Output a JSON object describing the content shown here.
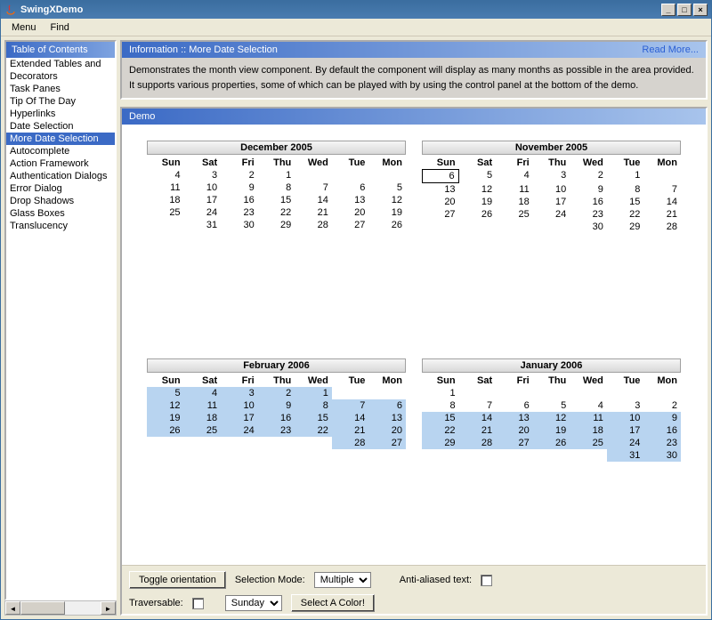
{
  "window": {
    "title": "SwingXDemo"
  },
  "menubar": {
    "items": [
      "Menu",
      "Find"
    ]
  },
  "sidebar": {
    "header": "Table of Contents",
    "items": [
      "Extended Tables and",
      "Decorators",
      "Task Panes",
      "Tip Of The Day",
      "Hyperlinks",
      "Date Selection",
      "More Date Selection",
      "Autocomplete",
      "Action Framework",
      "Authentication Dialogs",
      "Error Dialog",
      "Drop Shadows",
      "Glass Boxes",
      "Translucency"
    ],
    "selected_index": 6
  },
  "info": {
    "header": "Information :: More Date Selection",
    "read_more": "Read More...",
    "body": "Demonstrates the month view component. By default the component will display as many months as possible in the area provided. It supports various properties, some of which can be played with by using the control panel at the bottom of the demo."
  },
  "demo": {
    "header": "Demo"
  },
  "months": {
    "top_left": {
      "label": "December 2005",
      "days": [
        "Sun",
        "Sat",
        "Fri",
        "Thu",
        "Wed",
        "Tue",
        "Mon"
      ],
      "weeks": [
        [
          "4",
          "3",
          "2",
          "1",
          "",
          "",
          ""
        ],
        [
          "11",
          "10",
          "9",
          "8",
          "7",
          "6",
          "5"
        ],
        [
          "18",
          "17",
          "16",
          "15",
          "14",
          "13",
          "12"
        ],
        [
          "25",
          "24",
          "23",
          "22",
          "21",
          "20",
          "19"
        ],
        [
          "",
          "31",
          "30",
          "29",
          "28",
          "27",
          "26"
        ]
      ]
    },
    "top_right": {
      "label": "November 2005",
      "days": [
        "Sun",
        "Sat",
        "Fri",
        "Thu",
        "Wed",
        "Tue",
        "Mon"
      ],
      "today": "6",
      "weeks": [
        [
          "6",
          "5",
          "4",
          "3",
          "2",
          "1",
          ""
        ],
        [
          "13",
          "12",
          "11",
          "10",
          "9",
          "8",
          "7"
        ],
        [
          "20",
          "19",
          "18",
          "17",
          "16",
          "15",
          "14"
        ],
        [
          "27",
          "26",
          "25",
          "24",
          "23",
          "22",
          "21"
        ],
        [
          "",
          "",
          "",
          "",
          "30",
          "29",
          "28"
        ]
      ]
    },
    "bottom_left": {
      "label": "February 2006",
      "days": [
        "Sun",
        "Sat",
        "Fri",
        "Thu",
        "Wed",
        "Tue",
        "Mon"
      ],
      "weeks": [
        [
          "5",
          "4",
          "3",
          "2",
          "1",
          "",
          ""
        ],
        [
          "12",
          "11",
          "10",
          "9",
          "8",
          "7",
          "6"
        ],
        [
          "19",
          "18",
          "17",
          "16",
          "15",
          "14",
          "13"
        ],
        [
          "26",
          "25",
          "24",
          "23",
          "22",
          "21",
          "20"
        ],
        [
          "",
          "",
          "",
          "",
          "",
          "28",
          "27"
        ]
      ],
      "highlight_all": true
    },
    "bottom_right": {
      "label": "January 2006",
      "days": [
        "Sun",
        "Sat",
        "Fri",
        "Thu",
        "Wed",
        "Tue",
        "Mon"
      ],
      "weeks": [
        [
          "1",
          "",
          "",
          "",
          "",
          "",
          ""
        ],
        [
          "8",
          "7",
          "6",
          "5",
          "4",
          "3",
          "2"
        ],
        [
          "15",
          "14",
          "13",
          "12",
          "11",
          "10",
          "9"
        ],
        [
          "22",
          "21",
          "20",
          "19",
          "18",
          "17",
          "16"
        ],
        [
          "29",
          "28",
          "27",
          "26",
          "25",
          "24",
          "23"
        ],
        [
          "",
          "",
          "",
          "",
          "",
          "31",
          "30"
        ]
      ],
      "highlight_from": {
        "row": 2,
        "col": 0
      }
    }
  },
  "controls": {
    "toggle_orientation": "Toggle orientation",
    "selection_mode_label": "Selection Mode:",
    "selection_mode_value": "Multiple",
    "anti_aliased_label": "Anti-aliased text:",
    "traversable_label": "Traversable:",
    "weekday_value": "Sunday",
    "select_color": "Select A Color!"
  }
}
